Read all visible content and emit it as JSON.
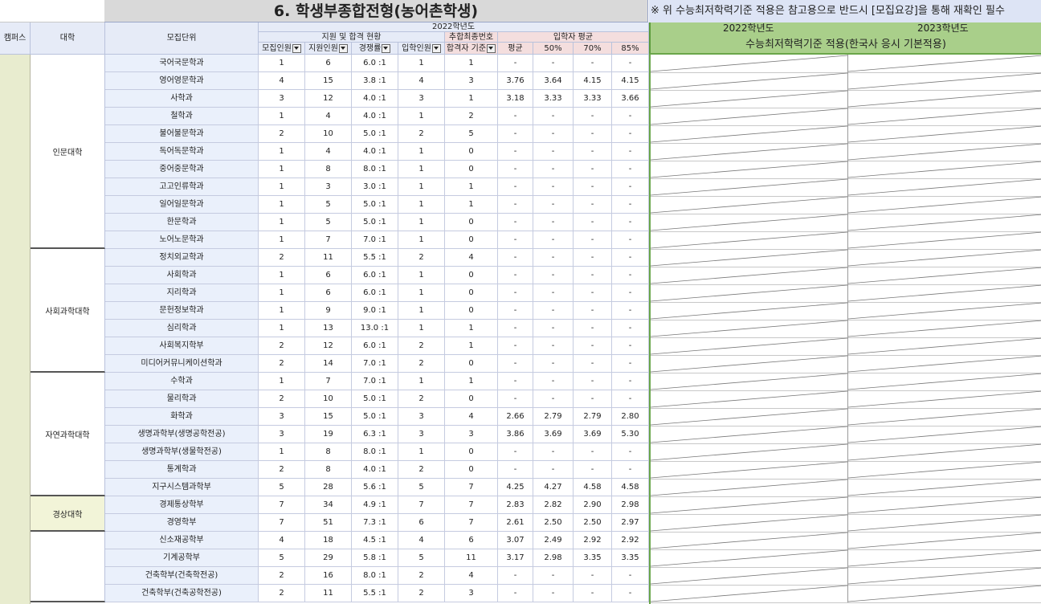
{
  "title": "6. 학생부종합전형(농어촌학생)",
  "notice": "※ 위 수능최저학력기준 적용은 참고용으로 반드시 [모집요강]을 통해 재확인 필수",
  "headers": {
    "campus": "캠퍼스",
    "college": "대학",
    "dept": "모집단위",
    "year2022": "2022학년도",
    "apply_group": "지원 및 합격 현황",
    "extra_group": "추합최종번호",
    "avg_group": "입학자 평균",
    "cols": [
      "모집인원",
      "지원인원",
      "경쟁률",
      "입학인원",
      "합격자 기준",
      "평균",
      "50%",
      "70%",
      "85%"
    ],
    "csat_year1": "2022학년도",
    "csat_year2": "2023학년도",
    "csat_title": "수능최저학력기준 적용(한국사 응시 기본적용)"
  },
  "colleges": [
    {
      "name": "인문대학",
      "rows": 11
    },
    {
      "name": "사회과학대학",
      "rows": 7
    },
    {
      "name": "자연과학대학",
      "rows": 7
    },
    {
      "name": "경상대학",
      "rows": 2
    },
    {
      "name": "",
      "rows": 4
    }
  ],
  "rows": [
    [
      "국어국문학과",
      "1",
      "6",
      "6.0 :1",
      "1",
      "1",
      "-",
      "-",
      "-",
      "-"
    ],
    [
      "영어영문학과",
      "4",
      "15",
      "3.8 :1",
      "4",
      "3",
      "3.76",
      "3.64",
      "4.15",
      "4.15"
    ],
    [
      "사학과",
      "3",
      "12",
      "4.0 :1",
      "3",
      "1",
      "3.18",
      "3.33",
      "3.33",
      "3.66"
    ],
    [
      "철학과",
      "1",
      "4",
      "4.0 :1",
      "1",
      "2",
      "-",
      "-",
      "-",
      "-"
    ],
    [
      "불어불문학과",
      "2",
      "10",
      "5.0 :1",
      "2",
      "5",
      "-",
      "-",
      "-",
      "-"
    ],
    [
      "독어독문학과",
      "1",
      "4",
      "4.0 :1",
      "1",
      "0",
      "-",
      "-",
      "-",
      "-"
    ],
    [
      "중어중문학과",
      "1",
      "8",
      "8.0 :1",
      "1",
      "0",
      "-",
      "-",
      "-",
      "-"
    ],
    [
      "고고인류학과",
      "1",
      "3",
      "3.0 :1",
      "1",
      "1",
      "-",
      "-",
      "-",
      "-"
    ],
    [
      "일어일문학과",
      "1",
      "5",
      "5.0 :1",
      "1",
      "1",
      "-",
      "-",
      "-",
      "-"
    ],
    [
      "한문학과",
      "1",
      "5",
      "5.0 :1",
      "1",
      "0",
      "-",
      "-",
      "-",
      "-"
    ],
    [
      "노어노문학과",
      "1",
      "7",
      "7.0 :1",
      "1",
      "0",
      "-",
      "-",
      "-",
      "-"
    ],
    [
      "정치외교학과",
      "2",
      "11",
      "5.5 :1",
      "2",
      "4",
      "-",
      "-",
      "-",
      "-"
    ],
    [
      "사회학과",
      "1",
      "6",
      "6.0 :1",
      "1",
      "0",
      "-",
      "-",
      "-",
      "-"
    ],
    [
      "지리학과",
      "1",
      "6",
      "6.0 :1",
      "1",
      "0",
      "-",
      "-",
      "-",
      "-"
    ],
    [
      "문헌정보학과",
      "1",
      "9",
      "9.0 :1",
      "1",
      "0",
      "-",
      "-",
      "-",
      "-"
    ],
    [
      "심리학과",
      "1",
      "13",
      "13.0 :1",
      "1",
      "1",
      "-",
      "-",
      "-",
      "-"
    ],
    [
      "사회복지학부",
      "2",
      "12",
      "6.0 :1",
      "2",
      "1",
      "-",
      "-",
      "-",
      "-"
    ],
    [
      "미디어커뮤니케이션학과",
      "2",
      "14",
      "7.0 :1",
      "2",
      "0",
      "-",
      "-",
      "-",
      "-"
    ],
    [
      "수학과",
      "1",
      "7",
      "7.0 :1",
      "1",
      "1",
      "-",
      "-",
      "-",
      "-"
    ],
    [
      "물리학과",
      "2",
      "10",
      "5.0 :1",
      "2",
      "0",
      "-",
      "-",
      "-",
      "-"
    ],
    [
      "화학과",
      "3",
      "15",
      "5.0 :1",
      "3",
      "4",
      "2.66",
      "2.79",
      "2.79",
      "2.80"
    ],
    [
      "생명과학부(생명공학전공)",
      "3",
      "19",
      "6.3 :1",
      "3",
      "3",
      "3.86",
      "3.69",
      "3.69",
      "5.30"
    ],
    [
      "생명과학부(생물학전공)",
      "1",
      "8",
      "8.0 :1",
      "1",
      "0",
      "-",
      "-",
      "-",
      "-"
    ],
    [
      "통계학과",
      "2",
      "8",
      "4.0 :1",
      "2",
      "0",
      "-",
      "-",
      "-",
      "-"
    ],
    [
      "지구시스템과학부",
      "5",
      "28",
      "5.6 :1",
      "5",
      "7",
      "4.25",
      "4.27",
      "4.58",
      "4.58"
    ],
    [
      "경제통상학부",
      "7",
      "34",
      "4.9 :1",
      "7",
      "7",
      "2.83",
      "2.82",
      "2.90",
      "2.98"
    ],
    [
      "경영학부",
      "7",
      "51",
      "7.3 :1",
      "6",
      "7",
      "2.61",
      "2.50",
      "2.50",
      "2.97"
    ],
    [
      "신소재공학부",
      "4",
      "18",
      "4.5 :1",
      "4",
      "6",
      "3.07",
      "2.49",
      "2.92",
      "2.92"
    ],
    [
      "기계공학부",
      "5",
      "29",
      "5.8 :1",
      "5",
      "11",
      "3.17",
      "2.98",
      "3.35",
      "3.35"
    ],
    [
      "건축학부(건축학전공)",
      "2",
      "16",
      "8.0 :1",
      "2",
      "4",
      "-",
      "-",
      "-",
      "-"
    ],
    [
      "건축학부(건축공학전공)",
      "2",
      "11",
      "5.5 :1",
      "2",
      "3",
      "-",
      "-",
      "-",
      "-"
    ]
  ]
}
